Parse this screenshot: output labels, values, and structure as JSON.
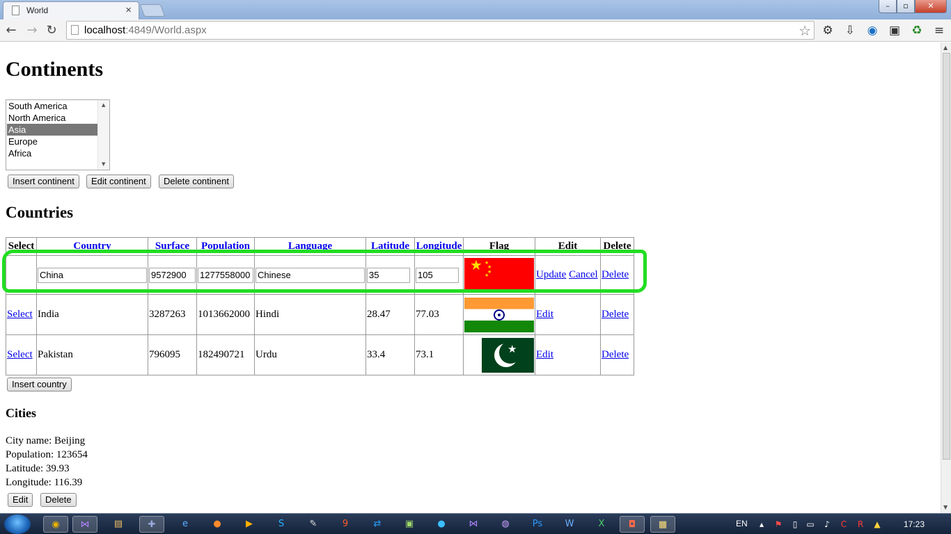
{
  "browser": {
    "tab_title": "World",
    "tab_close": "×",
    "url_host": "localhost",
    "url_rest": ":4849/World.aspx",
    "back": "←",
    "forward": "→",
    "reload": "↻",
    "star": "☆"
  },
  "window_controls": {
    "minimize": "–",
    "maximize": "▫",
    "close": "✕"
  },
  "extensions": [
    "gear-icon",
    "download-icon",
    "globe-icon",
    "photo-icon",
    "recycle-icon",
    "menu-icon"
  ],
  "extension_glyphs": [
    "⚙",
    "⇩",
    "◉",
    "▣",
    "♻",
    "≡"
  ],
  "page": {
    "heading": "Continents",
    "continents": [
      "South America",
      "North America",
      "Asia",
      "Europe",
      "Africa"
    ],
    "selected_continent": "Asia",
    "continent_buttons": {
      "insert": "Insert continent",
      "edit": "Edit continent",
      "delete": "Delete continent"
    },
    "countries_heading": "Countries",
    "table": {
      "headers": [
        "Select",
        "Country",
        "Surface",
        "Population",
        "Language",
        "Latitude",
        "Longitude",
        "Flag",
        "Edit",
        "Delete"
      ],
      "edit_row": {
        "country": "China",
        "surface": "9572900",
        "population": "1277558000",
        "language": "Chinese",
        "latitude": "35",
        "longitude": "105",
        "update": "Update",
        "cancel": "Cancel",
        "delete": "Delete"
      },
      "rows": [
        {
          "select": "Select",
          "country": "India",
          "surface": "3287263",
          "population": "1013662000",
          "language": "Hindi",
          "latitude": "28.47",
          "longitude": "77.03",
          "edit": "Edit",
          "delete": "Delete"
        },
        {
          "select": "Select",
          "country": "Pakistan",
          "surface": "796095",
          "population": "182490721",
          "language": "Urdu",
          "latitude": "33.4",
          "longitude": "73.1",
          "edit": "Edit",
          "delete": "Delete"
        }
      ]
    },
    "insert_country": "Insert country",
    "cities_heading": "Cities",
    "city": {
      "name": "City name: Beijing",
      "population": "Population: 123654",
      "latitude": "Latitude: 39.93",
      "longitude": "Longitude: 116.39"
    },
    "city_buttons": {
      "edit": "Edit",
      "delete": "Delete"
    }
  },
  "taskbar": {
    "apps": [
      "chrome-icon",
      "visual-studio-icon",
      "explorer-icon",
      "tools-icon",
      "ie-icon",
      "firefox-icon",
      "media-icon",
      "skype-icon",
      "notepad-icon",
      "app9-icon",
      "teamviewer-icon",
      "notepadpp-icon",
      "app13-icon",
      "vs2-icon",
      "orb-icon",
      "photoshop-icon",
      "word-icon",
      "excel-icon",
      "app19-icon",
      "notes-icon"
    ],
    "language": "EN",
    "time": "17:23"
  },
  "colors": {
    "highlight": "#22dd22",
    "link": "#0000ee",
    "selected_option": "#777777"
  }
}
